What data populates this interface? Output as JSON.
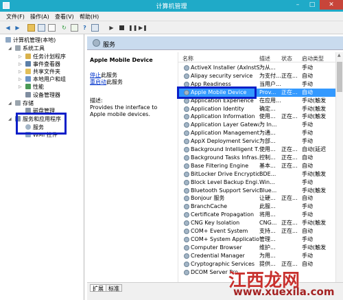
{
  "window": {
    "title": "计算机管理",
    "minimize": "–",
    "maximize": "□",
    "close": "✕"
  },
  "menu": [
    "文件(F)",
    "操作(A)",
    "查看(V)",
    "帮助(H)"
  ],
  "tree": {
    "root": "计算机管理(本地)",
    "system_tools": "系统工具",
    "task_scheduler": "任务计划程序",
    "event_viewer": "事件查看器",
    "shared_folders": "共享文件夹",
    "local_users": "本地用户和组",
    "performance": "性能",
    "device_manager": "设备管理器",
    "storage": "存储",
    "disk_mgmt": "磁盘管理",
    "services_apps": "服务和应用程序",
    "services": "服务",
    "wmi": "WMI 控件"
  },
  "panel": {
    "title": "服务"
  },
  "detail": {
    "name": "Apple Mobile Device",
    "stop_link": "停止",
    "stop_suffix": "此服务",
    "restart_link": "重启动",
    "restart_suffix": "此服务",
    "desc_label": "描述:",
    "description": "Provides the interface to Apple mobile devices."
  },
  "columns": [
    "名称",
    "描述",
    "状态",
    "启动类型"
  ],
  "services": [
    {
      "name": "ActiveX Installer (AxInstSV)",
      "desc": "为从...",
      "status": "",
      "start": "手动"
    },
    {
      "name": "Alipay security service",
      "desc": "为支付...",
      "status": "正在...",
      "start": "自动"
    },
    {
      "name": "App Readiness",
      "desc": "当用户...",
      "status": "",
      "start": "手动"
    },
    {
      "name": "Apple Mobile Device",
      "desc": "Prov...",
      "status": "正在...",
      "start": "自动"
    },
    {
      "name": "Application Experience",
      "desc": "在应用...",
      "status": "",
      "start": "手动(触发"
    },
    {
      "name": "Application Identity",
      "desc": "确定...",
      "status": "",
      "start": "手动(触发"
    },
    {
      "name": "Application Information",
      "desc": "使用...",
      "status": "正在...",
      "start": "手动(触发"
    },
    {
      "name": "Application Layer Gatewa...",
      "desc": "为 In...",
      "status": "",
      "start": "手动"
    },
    {
      "name": "Application Management",
      "desc": "为通...",
      "status": "",
      "start": "手动"
    },
    {
      "name": "AppX Deployment Servic...",
      "desc": "为部...",
      "status": "",
      "start": "手动"
    },
    {
      "name": "Background Intelligent T...",
      "desc": "使用...",
      "status": "正在...",
      "start": "自动(延迟"
    },
    {
      "name": "Background Tasks Infras...",
      "desc": "控制...",
      "status": "正在...",
      "start": "自动"
    },
    {
      "name": "Base Filtering Engine",
      "desc": "基本...",
      "status": "正在...",
      "start": "自动"
    },
    {
      "name": "BitLocker Drive Encryptio...",
      "desc": "BDE...",
      "status": "",
      "start": "手动(触发"
    },
    {
      "name": "Block Level Backup Engi...",
      "desc": "Win...",
      "status": "",
      "start": "手动"
    },
    {
      "name": "Bluetooth Support Service",
      "desc": "Blue...",
      "status": "",
      "start": "手动(触发"
    },
    {
      "name": "Bonjour 服务",
      "desc": "让硬...",
      "status": "正在...",
      "start": "自动"
    },
    {
      "name": "BranchCache",
      "desc": "此服...",
      "status": "",
      "start": "手动"
    },
    {
      "name": "Certificate Propagation",
      "desc": "将用...",
      "status": "",
      "start": "手动"
    },
    {
      "name": "CNG Key Isolation",
      "desc": "CNG...",
      "status": "正在...",
      "start": "手动(触发"
    },
    {
      "name": "COM+ Event System",
      "desc": "支持...",
      "status": "正在...",
      "start": "自动"
    },
    {
      "name": "COM+ System Application",
      "desc": "管理...",
      "status": "",
      "start": "手动"
    },
    {
      "name": "Computer Browser",
      "desc": "维护...",
      "status": "",
      "start": "手动(触发"
    },
    {
      "name": "Credential Manager",
      "desc": "为用...",
      "status": "",
      "start": "手动"
    },
    {
      "name": "Cryptographic Services",
      "desc": "提供...",
      "status": "正在...",
      "start": "自动"
    },
    {
      "name": "DCOM Server Pro...",
      "desc": "",
      "status": "",
      "start": ""
    }
  ],
  "tabs": [
    "扩展",
    "标准"
  ],
  "watermark": {
    "title": "江西龙网",
    "url": "www.xuexila.com"
  }
}
